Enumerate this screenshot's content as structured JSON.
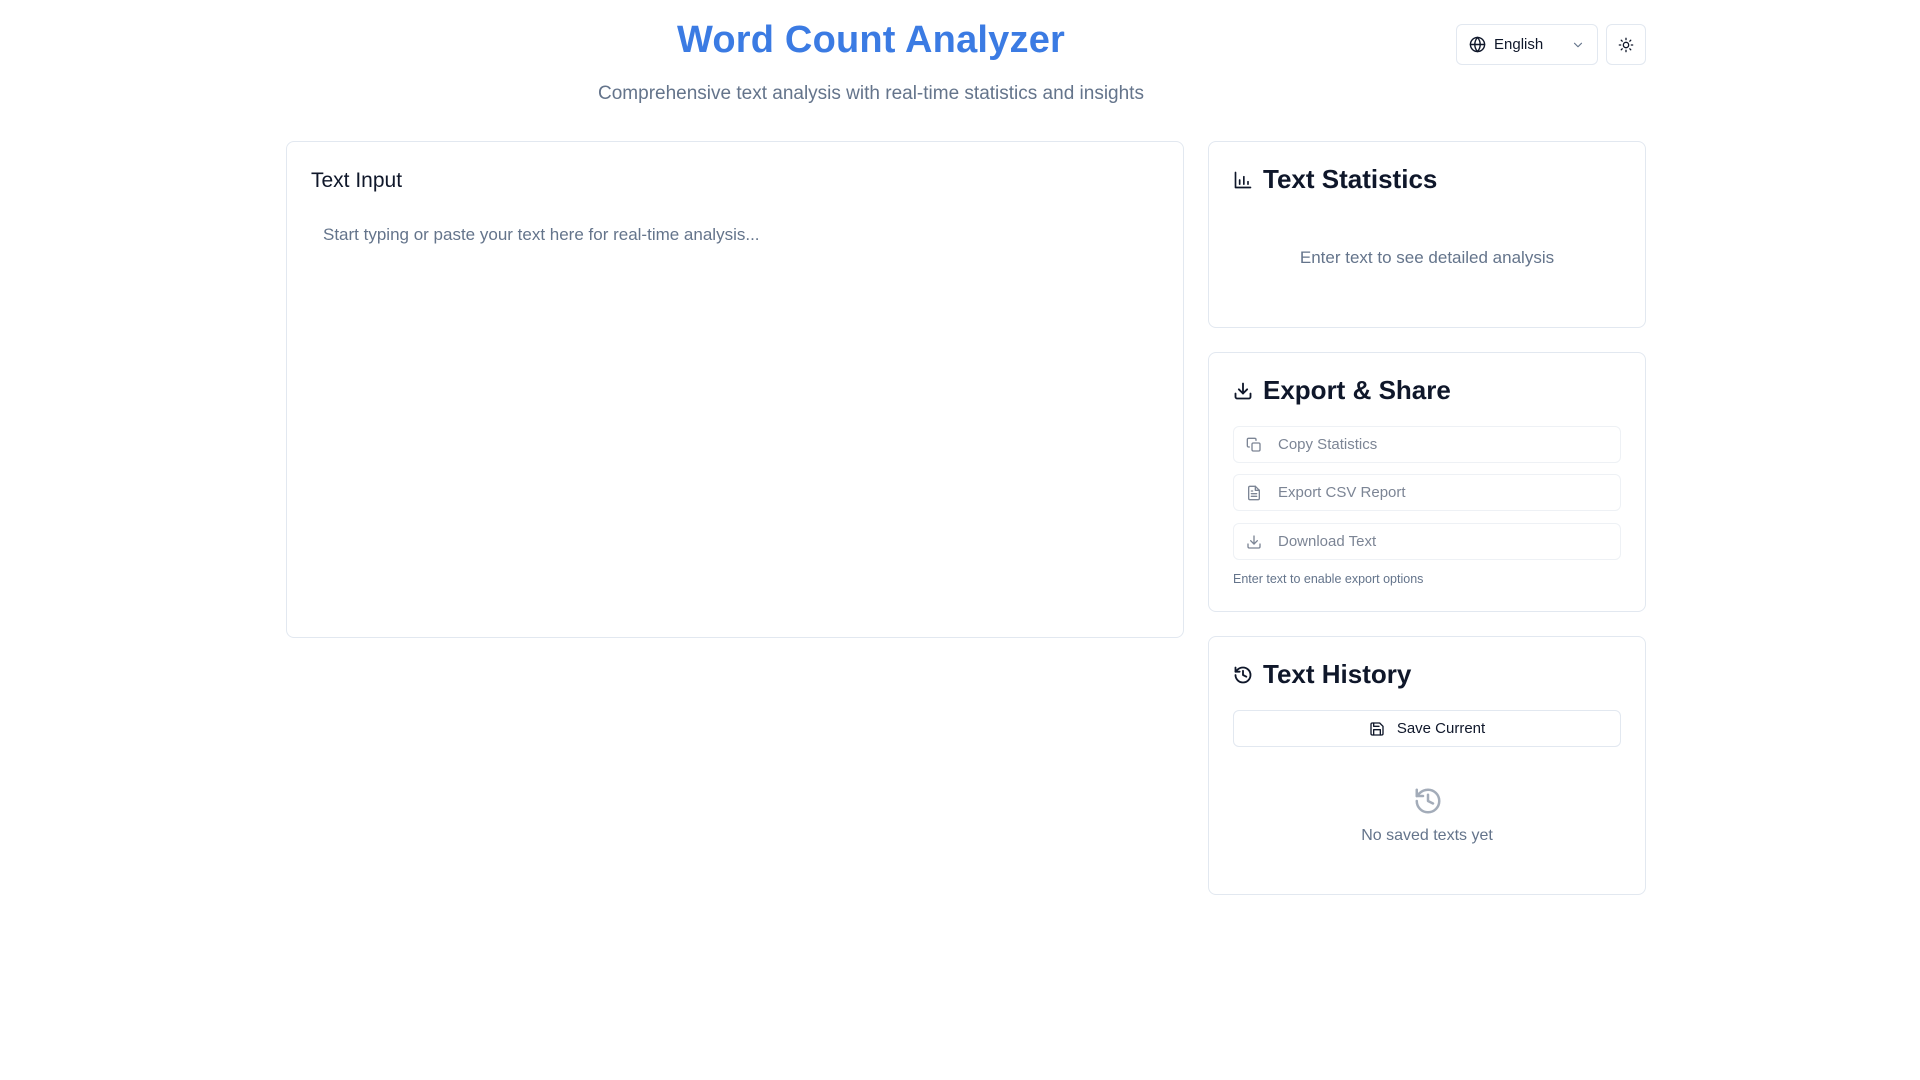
{
  "header": {
    "title": "Word Count Analyzer",
    "subtitle": "Comprehensive text analysis with real-time statistics and insights",
    "language": "English"
  },
  "input": {
    "title": "Text Input",
    "placeholder": "Start typing or paste your text here for real-time analysis...",
    "value": ""
  },
  "statistics": {
    "title": "Text Statistics",
    "empty_message": "Enter text to see detailed analysis"
  },
  "export": {
    "title": "Export & Share",
    "buttons": [
      {
        "label": "Copy Statistics",
        "icon": "copy-icon"
      },
      {
        "label": "Export CSV Report",
        "icon": "file-text-icon"
      },
      {
        "label": "Download Text",
        "icon": "download-icon"
      }
    ],
    "note": "Enter text to enable export options"
  },
  "history": {
    "title": "Text History",
    "save_label": "Save Current",
    "empty_message": "No saved texts yet"
  },
  "colors": {
    "accent": "#3b7be3",
    "muted_text": "#64748b",
    "border": "#e2e8f0"
  }
}
